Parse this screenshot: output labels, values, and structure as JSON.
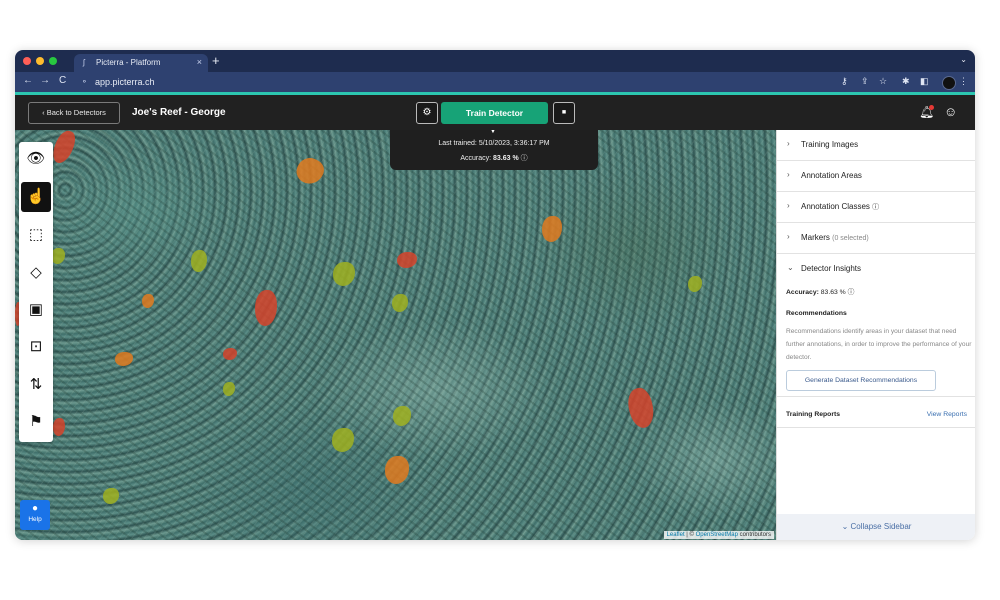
{
  "browser": {
    "tab_title": "Picterra - Platform",
    "tab_close": "×",
    "new_tab": "+",
    "url": "app.picterra.ch",
    "nav": {
      "back": "←",
      "forward": "→",
      "reload": "C"
    }
  },
  "header": {
    "back_label": "‹ Back to Detectors",
    "project_title": "Joe's Reef - George",
    "train_label": "Train Detector"
  },
  "training_status": {
    "last_trained": "Last trained: 5/10/2023, 3:36:17 PM",
    "accuracy_label": "Accuracy:",
    "accuracy_value": "83.63 %"
  },
  "sidebar": {
    "sections": [
      {
        "label": "Training Images"
      },
      {
        "label": "Annotation Areas"
      },
      {
        "label": "Annotation Classes"
      },
      {
        "label": "Markers",
        "sub": "(0 selected)"
      },
      {
        "label": "Detector Insights"
      }
    ],
    "insights": {
      "accuracy_label": "Accuracy:",
      "accuracy_value": "83.63 %",
      "recommendations_title": "Recommendations",
      "recommendations_text": "Recommendations identify areas in your dataset that need further annotations, in order to improve the performance of your detector.",
      "generate_button": "Generate Dataset Recommendations",
      "training_reports_label": "Training Reports",
      "view_reports_link": "View Reports"
    },
    "collapse_label": "Collapse Sidebar"
  },
  "map": {
    "attribution_leaflet": "Leaflet",
    "attribution_osm": "OpenStreetMap",
    "attribution_suffix": "contributors",
    "help_label": "Help"
  },
  "colors": {
    "accent": "#17a377",
    "chrome": "#2e4170",
    "header_bg": "#212121",
    "teal_bar": "#2cc6b0"
  },
  "icons": {
    "toolbar": [
      "eye-icon",
      "pan-hand-icon",
      "rectangle-select-icon",
      "polygon-icon",
      "square-tool-icon",
      "magic-select-icon",
      "swap-icon",
      "flag-icon"
    ]
  }
}
